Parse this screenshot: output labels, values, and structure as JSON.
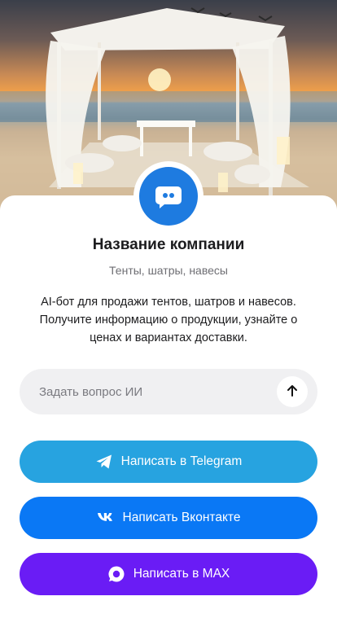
{
  "company": {
    "name": "Название компании",
    "tagline": "Тенты, шатры, навесы",
    "description": "AI-бот для продажи тентов, шатров и навесов. Получите информацию о продукции, узнайте о ценах и вариантах доставки."
  },
  "ask": {
    "placeholder": "Задать вопрос ИИ",
    "value": ""
  },
  "buttons": {
    "telegram": "Написать в Telegram",
    "vk": "Написать Вконтакте",
    "max": "Написать в MAX"
  },
  "colors": {
    "avatar": "#1e7be0",
    "telegram": "#27a3e0",
    "vk": "#0a78f5",
    "max": "#6a1cf5"
  },
  "icons": {
    "avatar": "chat-bot-icon",
    "send": "arrow-up-icon",
    "telegram": "telegram-icon",
    "vk": "vk-icon",
    "max": "max-icon"
  }
}
